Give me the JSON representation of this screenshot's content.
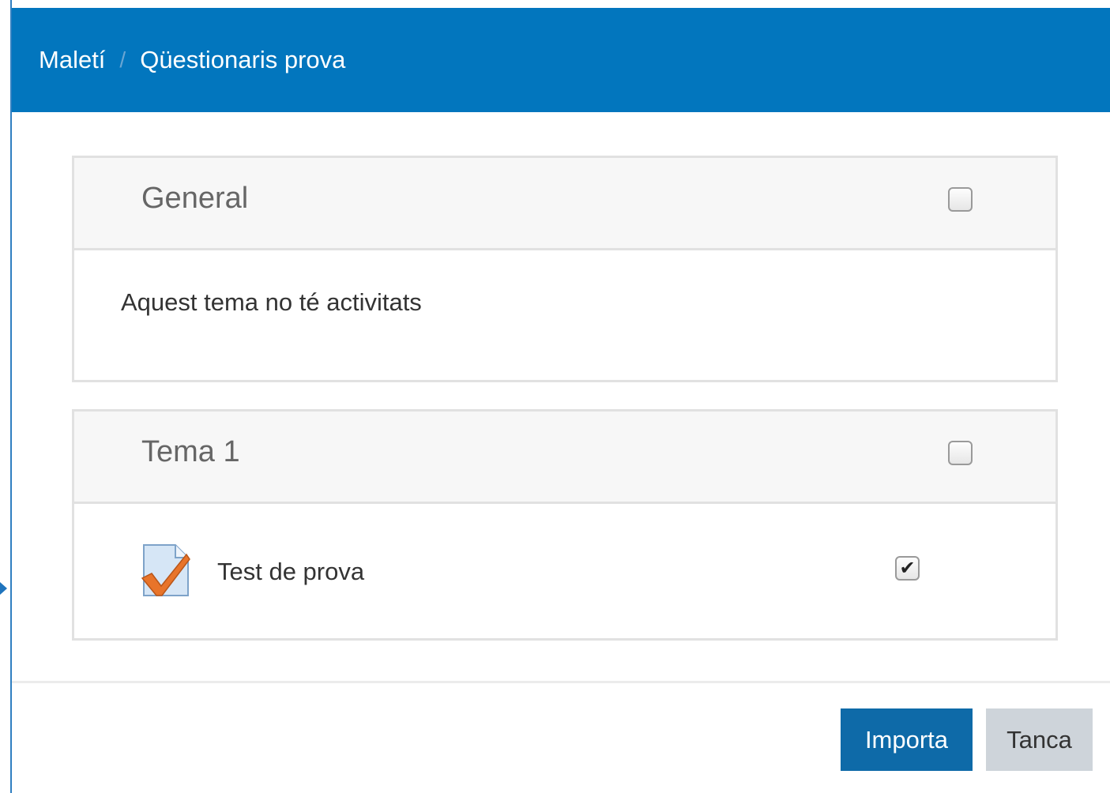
{
  "breadcrumb": {
    "root": "Maletí",
    "separator": "/",
    "current": "Qüestionaris prova"
  },
  "sections": [
    {
      "title": "General",
      "checked": false,
      "empty_text": "Aquest tema no té activitats"
    },
    {
      "title": "Tema 1",
      "checked": false,
      "activities": [
        {
          "name": "Test de prova",
          "icon": "quiz-icon",
          "checked": true,
          "tick": "✔"
        }
      ]
    }
  ],
  "buttons": {
    "import_label": "Importa",
    "close_label": "Tanca"
  },
  "colors": {
    "header_bg": "#0276be",
    "primary_button": "#0e6aa8",
    "secondary_button": "#ced4da"
  }
}
